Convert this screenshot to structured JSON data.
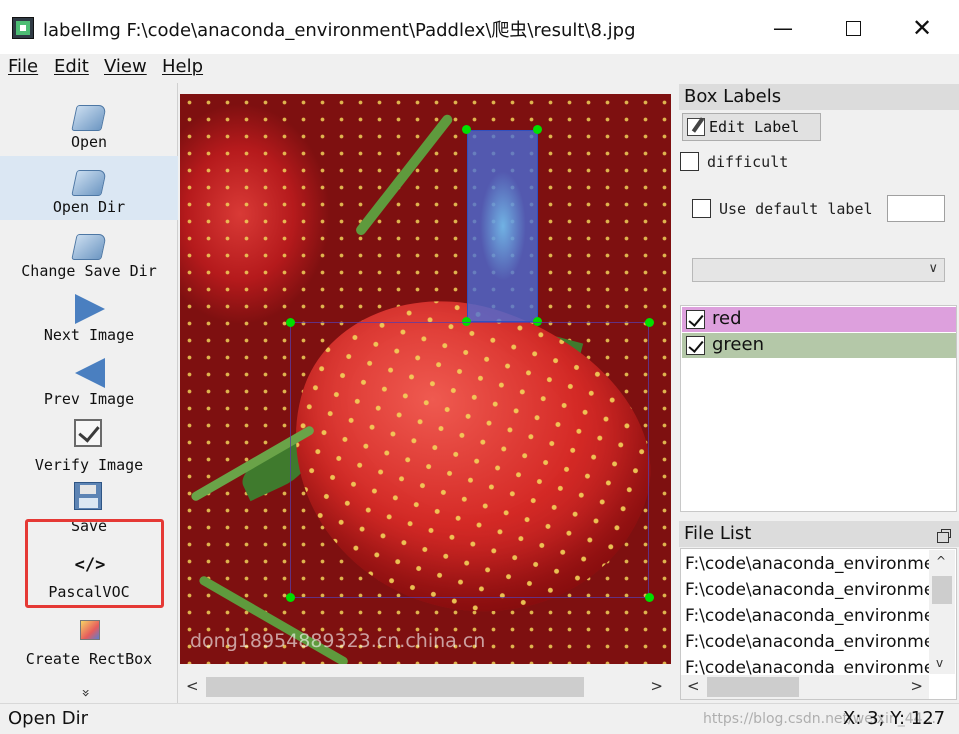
{
  "window": {
    "title": "labelImg F:\\code\\anaconda_environment\\Paddlex\\爬虫\\result\\8.jpg",
    "minimize_glyph": "—",
    "close_glyph": "✕"
  },
  "menu": {
    "items": [
      "File",
      "Edit",
      "View",
      "Help"
    ]
  },
  "toolbar": {
    "items": [
      {
        "label": "Open",
        "icon": "folder-open-icon"
      },
      {
        "label": "Open Dir",
        "icon": "folder-open-icon",
        "active": true
      },
      {
        "label": "Change Save Dir",
        "icon": "folder-open-icon"
      },
      {
        "label": "Next Image",
        "icon": "arrow-right-icon"
      },
      {
        "label": "Prev Image",
        "icon": "arrow-left-icon"
      },
      {
        "label": "Verify Image",
        "icon": "checkbox-icon"
      },
      {
        "label": "Save",
        "icon": "floppy-disk-icon"
      },
      {
        "label": "PascalVOC",
        "icon": "code-icon",
        "glyph": "</>"
      },
      {
        "label": "Create RectBox",
        "icon": "rect-box-icon"
      }
    ],
    "more_glyph": "»",
    "highlight_color": "#e53935"
  },
  "canvas": {
    "watermark": "dong18954889323.cn.china.cn",
    "boxes": [
      {
        "label": "red",
        "color": "#466edc"
      },
      {
        "label": "green",
        "color": "#5a3caa"
      }
    ],
    "handle_color": "#00e000"
  },
  "canvas_scroll": {
    "left_arrow": "<",
    "right_arrow": ">"
  },
  "box_labels": {
    "title": "Box Labels",
    "edit_label_button": "Edit Label",
    "difficult_label": "difficult",
    "use_default_label": "Use default label",
    "default_label_value": "",
    "labels": [
      {
        "name": "red",
        "checked": true,
        "color": "#dda0dd"
      },
      {
        "name": "green",
        "checked": true,
        "color": "#b4c8a8"
      }
    ]
  },
  "file_list": {
    "title": "File List",
    "files": [
      "F:\\code\\anaconda_environme",
      "F:\\code\\anaconda_environme",
      "F:\\code\\anaconda_environme",
      "F:\\code\\anaconda_environme",
      "F:\\code\\anaconda_environme"
    ],
    "up_arrow": "^",
    "down_arrow": "v",
    "left_arrow": "<",
    "right_arrow": ">"
  },
  "status": {
    "message": "Open Dir",
    "coords": "X: 3; Y: 127",
    "watermark": "https://blog.csdn.net/weixin_44..."
  }
}
